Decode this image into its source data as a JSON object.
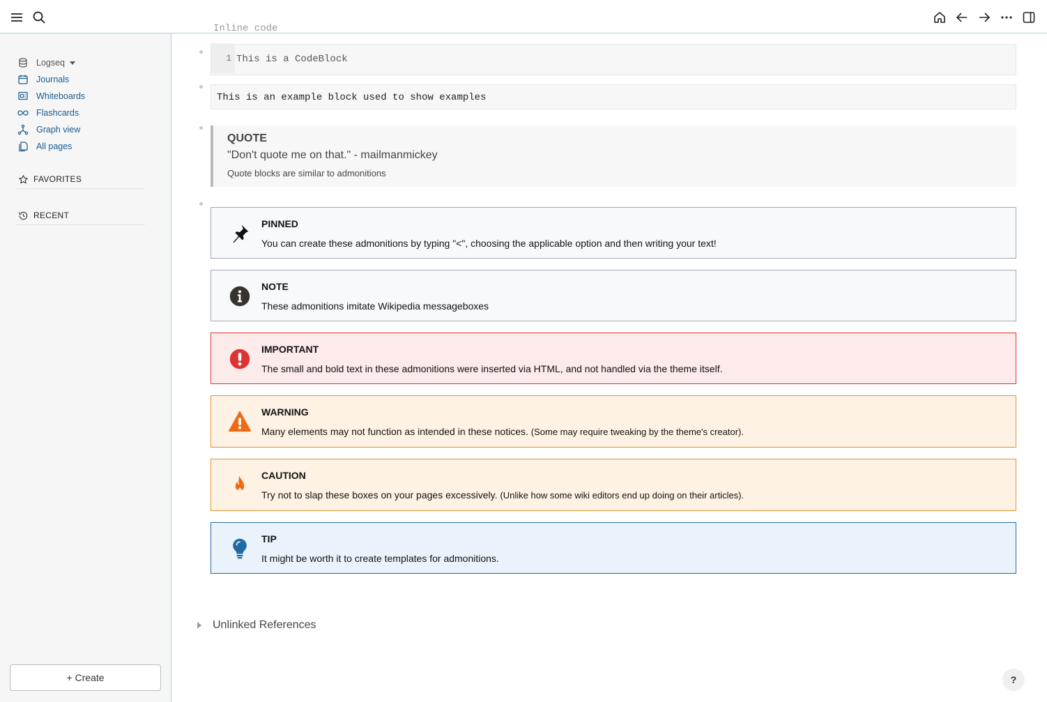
{
  "sidebar": {
    "graph_name": "Logseq",
    "items": [
      {
        "label": "Journals",
        "icon": "calendar-icon"
      },
      {
        "label": "Whiteboards",
        "icon": "whiteboard-icon"
      },
      {
        "label": "Flashcards",
        "icon": "infinity-icon"
      },
      {
        "label": "Graph view",
        "icon": "graph-icon"
      },
      {
        "label": "All pages",
        "icon": "pages-icon"
      }
    ],
    "favorites_label": "FAVORITES",
    "recent_label": "RECENT",
    "create_label": "+ Create"
  },
  "main": {
    "partial_text": "Inline code",
    "code_block": {
      "line_number": "1",
      "text": "This is a CodeBlock"
    },
    "example_block": "This is an example block used to show examples",
    "quote": {
      "title": "QUOTE",
      "body": "\"Don't quote me on that.\" - mailmanmickey",
      "sub": "Quote blocks are similar to admonitions"
    },
    "admonitions": [
      {
        "title": "PINNED",
        "body": "You can create these admonitions by typing \"<\", choosing the applicable option and then writing your text!",
        "small": "",
        "icon": "pin-icon"
      },
      {
        "title": "NOTE",
        "body": "These admonitions imitate Wikipedia messageboxes",
        "small": "",
        "icon": "info-icon"
      },
      {
        "title": "IMPORTANT",
        "body": "The small and bold text in these admonitions were inserted via HTML, and not handled via the theme itself.",
        "small": "",
        "icon": "exclamation-icon"
      },
      {
        "title": "WARNING",
        "body": "Many elements may not function as intended in these notices.",
        "small": "(Some may require tweaking by the theme's creator).",
        "icon": "warning-icon"
      },
      {
        "title": "CAUTION",
        "body": "Try not to slap these boxes on your pages excessively.",
        "small": "(Unlike how some wiki editors end up doing on their articles).",
        "icon": "flame-icon"
      },
      {
        "title": "TIP",
        "body": "It might be worth it to create templates for admonitions.",
        "small": "",
        "icon": "lightbulb-icon"
      }
    ],
    "unlinked_references": "Unlinked References",
    "help": "?"
  },
  "colors": {
    "link": "#1a5c8e",
    "important_bg": "#fdeaea",
    "important_border": "#dd3333",
    "warning_bg": "#fef2e4",
    "warning_border": "#e0932f",
    "tip_bg": "#eaf3fb",
    "tip_border": "#1f6aa5"
  }
}
